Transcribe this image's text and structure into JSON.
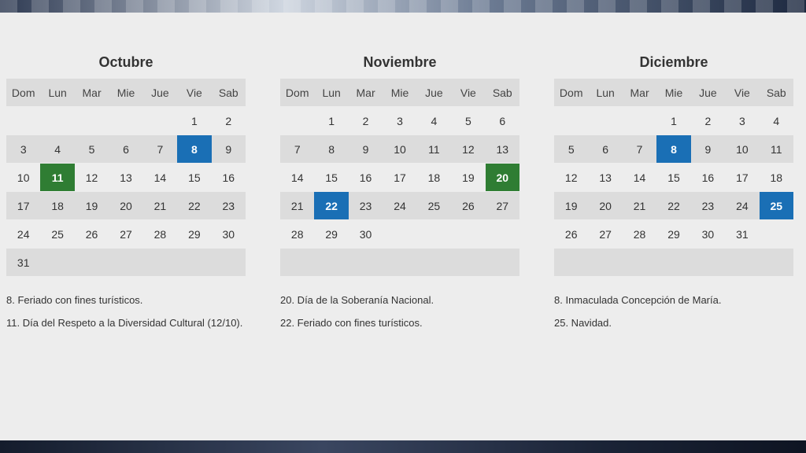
{
  "weekday_headers": [
    "Dom",
    "Lun",
    "Mar",
    "Mie",
    "Jue",
    "Vie",
    "Sab"
  ],
  "colors": {
    "blue": "#1a6fb5",
    "green": "#2f7d33",
    "panel": "#ededed",
    "row_alt": "#dcdcdc"
  },
  "months": [
    {
      "name": "Octubre",
      "weeks": [
        [
          "",
          "",
          "",
          "",
          "",
          "1",
          "2"
        ],
        [
          "3",
          "4",
          "5",
          "6",
          "7",
          "8",
          "9"
        ],
        [
          "10",
          "11",
          "12",
          "13",
          "14",
          "15",
          "16"
        ],
        [
          "17",
          "18",
          "19",
          "20",
          "21",
          "22",
          "23"
        ],
        [
          "24",
          "25",
          "26",
          "27",
          "28",
          "29",
          "30"
        ],
        [
          "31",
          "",
          "",
          "",
          "",
          "",
          ""
        ]
      ],
      "highlights": {
        "8": "blue",
        "11": "green"
      },
      "notes": [
        "8. Feriado con fines turísticos.",
        "11. Día del Respeto a la Diversidad Cultural (12/10)."
      ]
    },
    {
      "name": "Noviembre",
      "weeks": [
        [
          "",
          "1",
          "2",
          "3",
          "4",
          "5",
          "6"
        ],
        [
          "7",
          "8",
          "9",
          "10",
          "11",
          "12",
          "13"
        ],
        [
          "14",
          "15",
          "16",
          "17",
          "18",
          "19",
          "20"
        ],
        [
          "21",
          "22",
          "23",
          "24",
          "25",
          "26",
          "27"
        ],
        [
          "28",
          "29",
          "30",
          "",
          "",
          "",
          ""
        ],
        [
          "",
          "",
          "",
          "",
          "",
          "",
          ""
        ]
      ],
      "highlights": {
        "20": "green",
        "22": "blue"
      },
      "notes": [
        "20. Día de la Soberanía Nacional.",
        "22. Feriado con fines turísticos."
      ]
    },
    {
      "name": "Diciembre",
      "weeks": [
        [
          "",
          "",
          "",
          "1",
          "2",
          "3",
          "4"
        ],
        [
          "5",
          "6",
          "7",
          "8",
          "9",
          "10",
          "11"
        ],
        [
          "12",
          "13",
          "14",
          "15",
          "16",
          "17",
          "18"
        ],
        [
          "19",
          "20",
          "21",
          "22",
          "23",
          "24",
          "25"
        ],
        [
          "26",
          "27",
          "28",
          "29",
          "30",
          "31",
          ""
        ],
        [
          "",
          "",
          "",
          "",
          "",
          "",
          ""
        ]
      ],
      "highlights": {
        "8": "blue",
        "25": "blue"
      },
      "notes": [
        "8. Inmaculada Concepción de María.",
        "25. Navidad."
      ]
    }
  ]
}
